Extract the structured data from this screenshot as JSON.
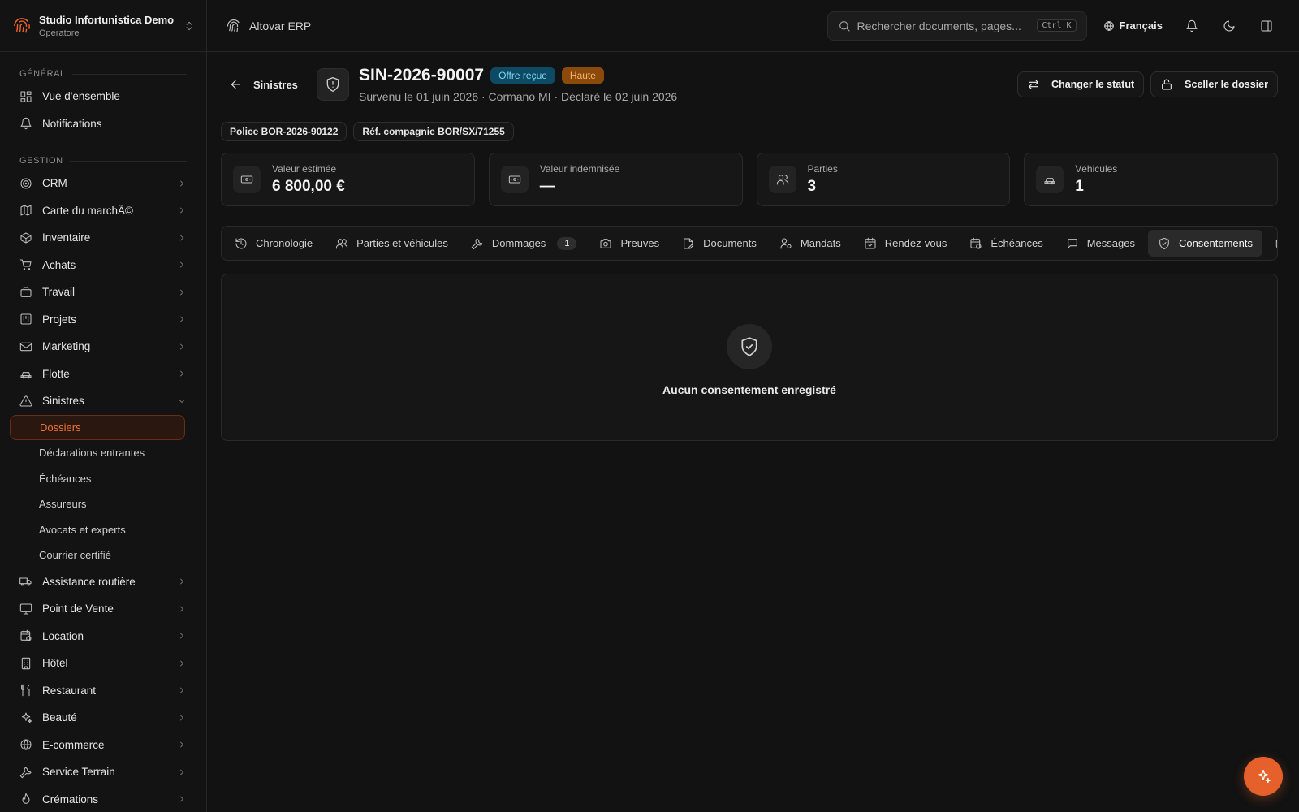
{
  "sidebar": {
    "org_name": "Studio Infortunistica Demo",
    "org_role": "Operatore",
    "sections": [
      {
        "label": "GÉNÉRAL",
        "items": [
          {
            "label": "Vue d'ensemble",
            "icon": "layout-grid-icon"
          },
          {
            "label": "Notifications",
            "icon": "bell-icon"
          }
        ]
      },
      {
        "label": "GESTION",
        "items": [
          {
            "label": "CRM",
            "icon": "target-icon"
          },
          {
            "label": "Carte du marchÃ©",
            "icon": "map-icon"
          },
          {
            "label": "Inventaire",
            "icon": "box-icon"
          },
          {
            "label": "Achats",
            "icon": "cart-icon"
          },
          {
            "label": "Travail",
            "icon": "briefcase-icon"
          },
          {
            "label": "Projets",
            "icon": "kanban-icon"
          },
          {
            "label": "Marketing",
            "icon": "mail-icon"
          },
          {
            "label": "Flotte",
            "icon": "car-icon"
          },
          {
            "label": "Sinistres",
            "icon": "warning-icon",
            "expanded": true,
            "children": [
              "Dossiers",
              "Déclarations entrantes",
              "Échéances",
              "Assureurs",
              "Avocats et experts",
              "Courrier certifié"
            ],
            "active_child": "Dossiers"
          },
          {
            "label": "Assistance routière",
            "icon": "truck-icon"
          },
          {
            "label": "Point de Vente",
            "icon": "monitor-icon"
          },
          {
            "label": "Location",
            "icon": "calendar-clock-icon"
          },
          {
            "label": "Hôtel",
            "icon": "building-icon"
          },
          {
            "label": "Restaurant",
            "icon": "utensils-icon"
          },
          {
            "label": "Beauté",
            "icon": "sparkles-icon"
          },
          {
            "label": "E-commerce",
            "icon": "globe-icon"
          },
          {
            "label": "Service Terrain",
            "icon": "wrench-icon"
          },
          {
            "label": "Crémations",
            "icon": "flame-icon"
          }
        ]
      }
    ]
  },
  "topbar": {
    "brand": "Altovar ERP",
    "search_placeholder": "Rechercher documents, pages...",
    "shortcut": "Ctrl K",
    "language": "Français"
  },
  "case": {
    "back_label": "Sinistres",
    "id": "SIN-2026-90007",
    "status": "Offre reçue",
    "priority": "Haute",
    "subtitle": "Survenu le 01 juin 2026 · Cormano MI · Déclaré le 02 juin 2026",
    "actions": {
      "change_status": "Changer le statut",
      "seal": "Sceller le dossier"
    },
    "tags": [
      "Police BOR-2026-90122",
      "Réf. compagnie BOR/SX/71255"
    ]
  },
  "stats": [
    {
      "label": "Valeur estimée",
      "value": "6 800,00 €",
      "icon": "banknote-icon"
    },
    {
      "label": "Valeur indemnisée",
      "value": "—",
      "icon": "banknote-icon"
    },
    {
      "label": "Parties",
      "value": "3",
      "icon": "users-icon"
    },
    {
      "label": "Véhicules",
      "value": "1",
      "icon": "car-icon"
    }
  ],
  "tabs": [
    {
      "label": "Chronologie",
      "icon": "history-icon"
    },
    {
      "label": "Parties et véhicules",
      "icon": "users-icon"
    },
    {
      "label": "Dommages",
      "icon": "wrench-icon",
      "count": "1"
    },
    {
      "label": "Preuves",
      "icon": "camera-icon"
    },
    {
      "label": "Documents",
      "icon": "file-edit-icon"
    },
    {
      "label": "Mandats",
      "icon": "user-cog-icon"
    },
    {
      "label": "Rendez-vous",
      "icon": "calendar-check-icon"
    },
    {
      "label": "Échéances",
      "icon": "calendar-clock-icon"
    },
    {
      "label": "Messages",
      "icon": "message-icon"
    },
    {
      "label": "Consentements",
      "icon": "shield-check-icon",
      "active": true
    },
    {
      "label": "",
      "icon": "mail-icon"
    }
  ],
  "empty_state": {
    "text": "Aucun consentement enregistré",
    "icon": "shield-check-icon"
  },
  "colors": {
    "accent": "#e5602a",
    "status_badge": "#0e4a63",
    "priority_badge": "#8a4a0c",
    "background": "#121212"
  }
}
